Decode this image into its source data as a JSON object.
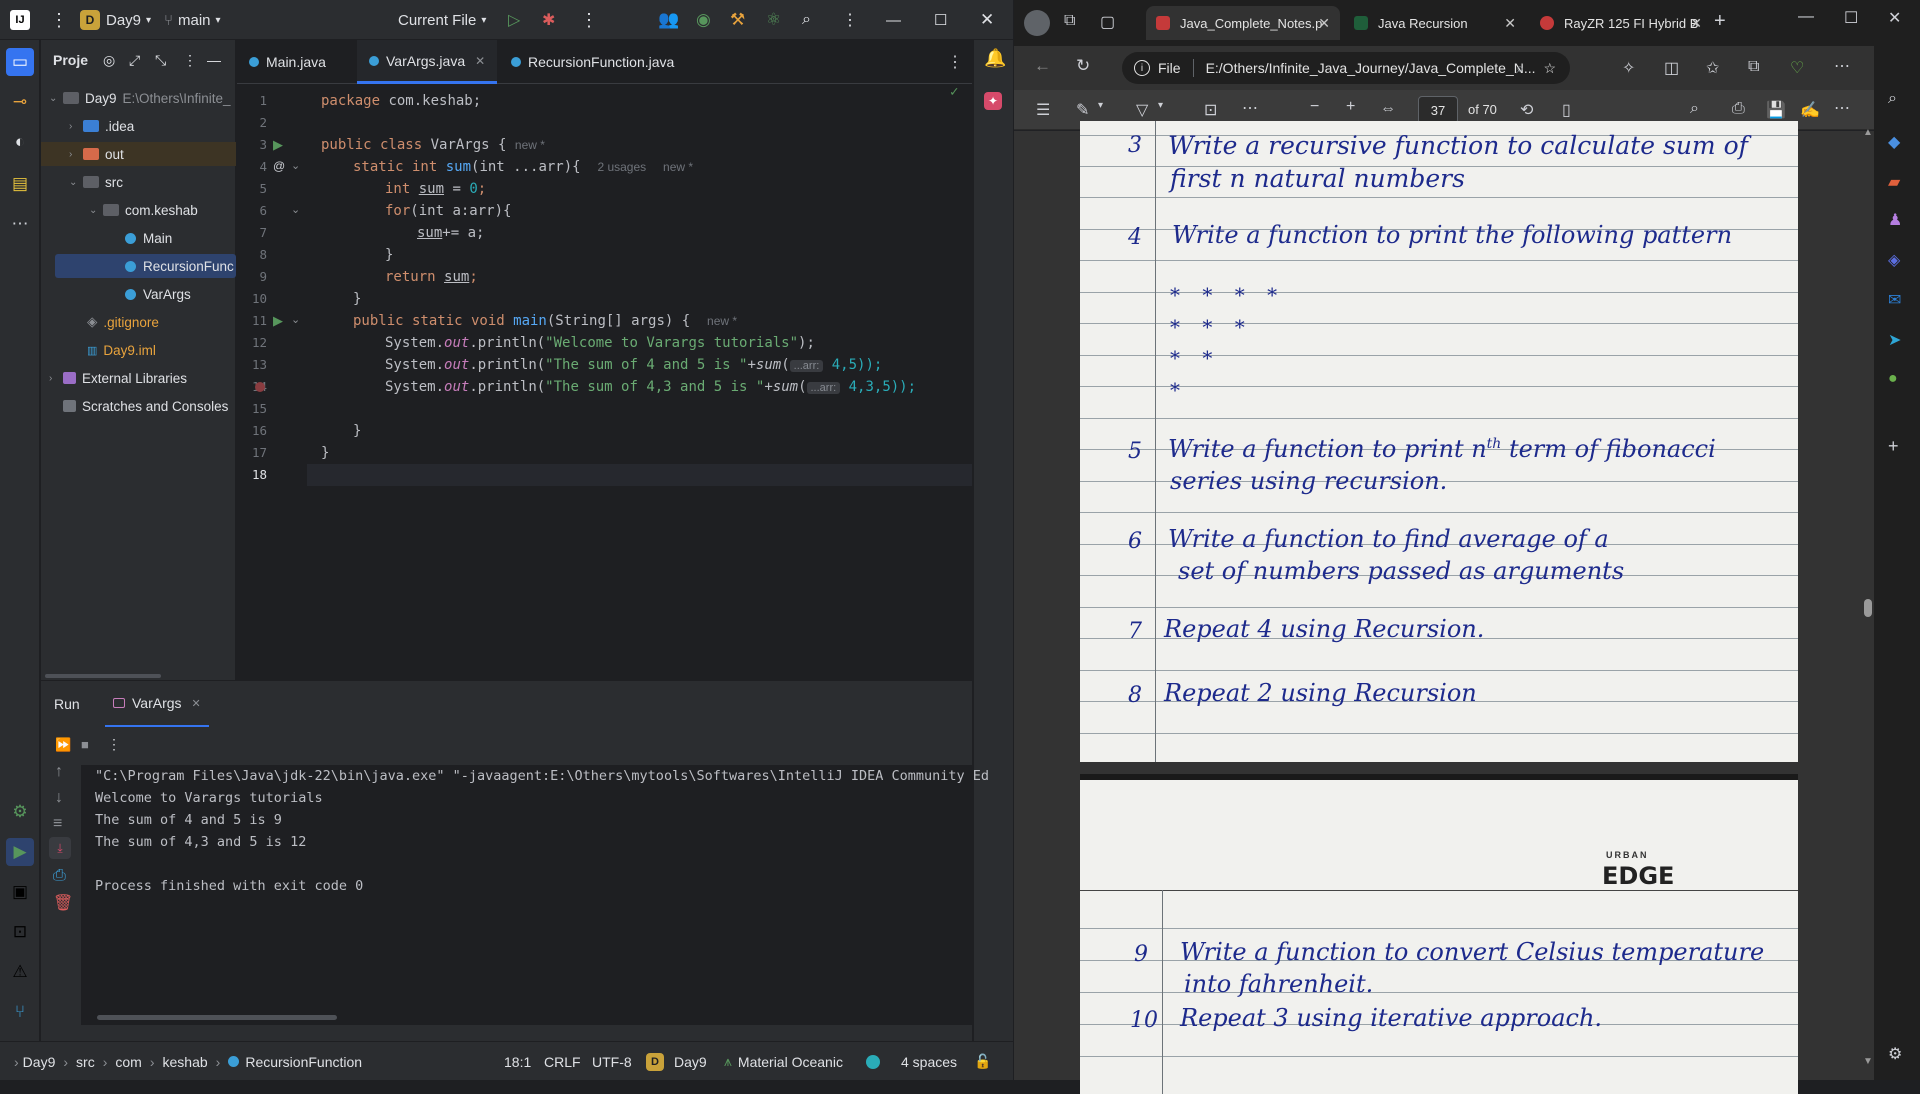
{
  "ide": {
    "project_name": "Day9",
    "branch": "main",
    "run_config": "Current File",
    "project_label": "Proje",
    "tree": {
      "root": "Day9",
      "root_path": "E:\\Others\\Infinite_",
      "idea": ".idea",
      "out": "out",
      "src": "src",
      "pkg": "com.keshab",
      "main": "Main",
      "recursion": "RecursionFunc",
      "varargs": "VarArgs",
      "gitignore": ".gitignore",
      "iml": "Day9.iml",
      "extlib": "External Libraries",
      "scratches": "Scratches and Consoles"
    },
    "tabs": [
      "Main.java",
      "VarArgs.java",
      "RecursionFunction.java"
    ],
    "line_numbers": [
      "1",
      "2",
      "3",
      "4",
      "5",
      "6",
      "7",
      "8",
      "9",
      "10",
      "11",
      "12",
      "13",
      "14",
      "15",
      "16",
      "17",
      "18"
    ],
    "code": {
      "l1_kw": "package",
      "l1_rest": " com.keshab;",
      "l3_kw": "public class",
      "l3_name": " VarArgs {",
      "l3_hint": "new *",
      "l4_kw": "static int",
      "l4_fn": " sum",
      "l4_rest": "(int ...arr){",
      "l4_hint1": "2 usages",
      "l4_hint2": "new *",
      "l5_kw": "int",
      "l5_var": "sum",
      "l5_rest": " = ",
      "l5_num": "0",
      "l5_end": ";",
      "l6_kw": "for",
      "l6_rest": "(int a:arr){",
      "l7_var": "sum",
      "l7_rest": "+= a;",
      "l8": "}",
      "l9_kw": "return",
      "l9_var": "sum",
      "l9_end": ";",
      "l10": "}",
      "l11_kw": "public static void",
      "l11_fn": " main",
      "l11_rest": "(String[] args) {",
      "l11_hint": "new *",
      "l12_a": "System.",
      "l12_out": "out",
      "l12_b": ".println(",
      "l12_str": "\"Welcome to Varargs tutorials\"",
      "l12_c": ");",
      "l13_a": "System.",
      "l13_out": "out",
      "l13_b": ".println(",
      "l13_str": "\"The sum of 4 and 5 is \"",
      "l13_c": "+",
      "l13_fn": "sum",
      "l13_d": "(",
      "l13_inl": "...arr:",
      "l13_e": "4,5));",
      "l14_a": "System.",
      "l14_out": "out",
      "l14_b": ".println(",
      "l14_str": "\"The sum of 4,3 and 5 is \"",
      "l14_c": "+",
      "l14_fn": "sum",
      "l14_d": "(",
      "l14_inl": "...arr:",
      "l14_e": "4,3,5));",
      "l16": "}",
      "l17": "}"
    },
    "run": {
      "tab_run": "Run",
      "tab_config": "VarArgs",
      "console": [
        "\"C:\\Program Files\\Java\\jdk-22\\bin\\java.exe\" \"-javaagent:E:\\Others\\mytools\\Softwares\\IntelliJ IDEA Community Ed",
        "Welcome to Varargs tutorials",
        "The sum of 4 and 5 is 9",
        "The sum of 4,3 and 5 is 12",
        "",
        "Process finished with exit code 0"
      ]
    },
    "status": {
      "crumbs": [
        "Day9",
        "src",
        "com",
        "keshab",
        "RecursionFunction"
      ],
      "position": "18:1",
      "line_sep": "CRLF",
      "encoding": "UTF-8",
      "project": "Day9",
      "theme": "Material Oceanic",
      "indent": "4 spaces"
    }
  },
  "browser": {
    "tabs": [
      {
        "title": "Java_Complete_Notes.p"
      },
      {
        "title": "Java Recursion"
      },
      {
        "title": "RayZR 125 FI Hybrid B"
      }
    ],
    "file_label": "File",
    "url": "E:/Others/Infinite_Java_Journey/Java_Complete_N...",
    "page_current": "37",
    "page_total": "of 70",
    "notes": {
      "q3_num": "3",
      "q3_l1": "Write a recursive function to calculate sum of",
      "q3_l2": "first n natural numbers",
      "q4_num": "4",
      "q4_l1": "Write a function to print the following pattern",
      "pattern": [
        "* * * *",
        "* * *",
        "* *",
        "*"
      ],
      "q5_num": "5",
      "q5_l1": "Write a function to print n",
      "q5_sup": "th",
      "q5_l1b": " term of fibonacci",
      "q5_l2": "series using recursion.",
      "q6_num": "6",
      "q6_l1": "Write a function to find average of a",
      "q6_l2": "set of numbers passed as arguments",
      "q7_num": "7",
      "q7_l1": "Repeat 4 using Recursion.",
      "q8_num": "8",
      "q8_l1": "Repeat 2 using Recursion",
      "brand_small": "URBAN",
      "brand": "EDGE",
      "q9_num": "9",
      "q9_l1": "Write a function to convert Celsius temperature",
      "q9_l2": "into fahrenheit.",
      "q10_num": "10",
      "q10_l1": "Repeat 3 using iterative approach."
    }
  }
}
